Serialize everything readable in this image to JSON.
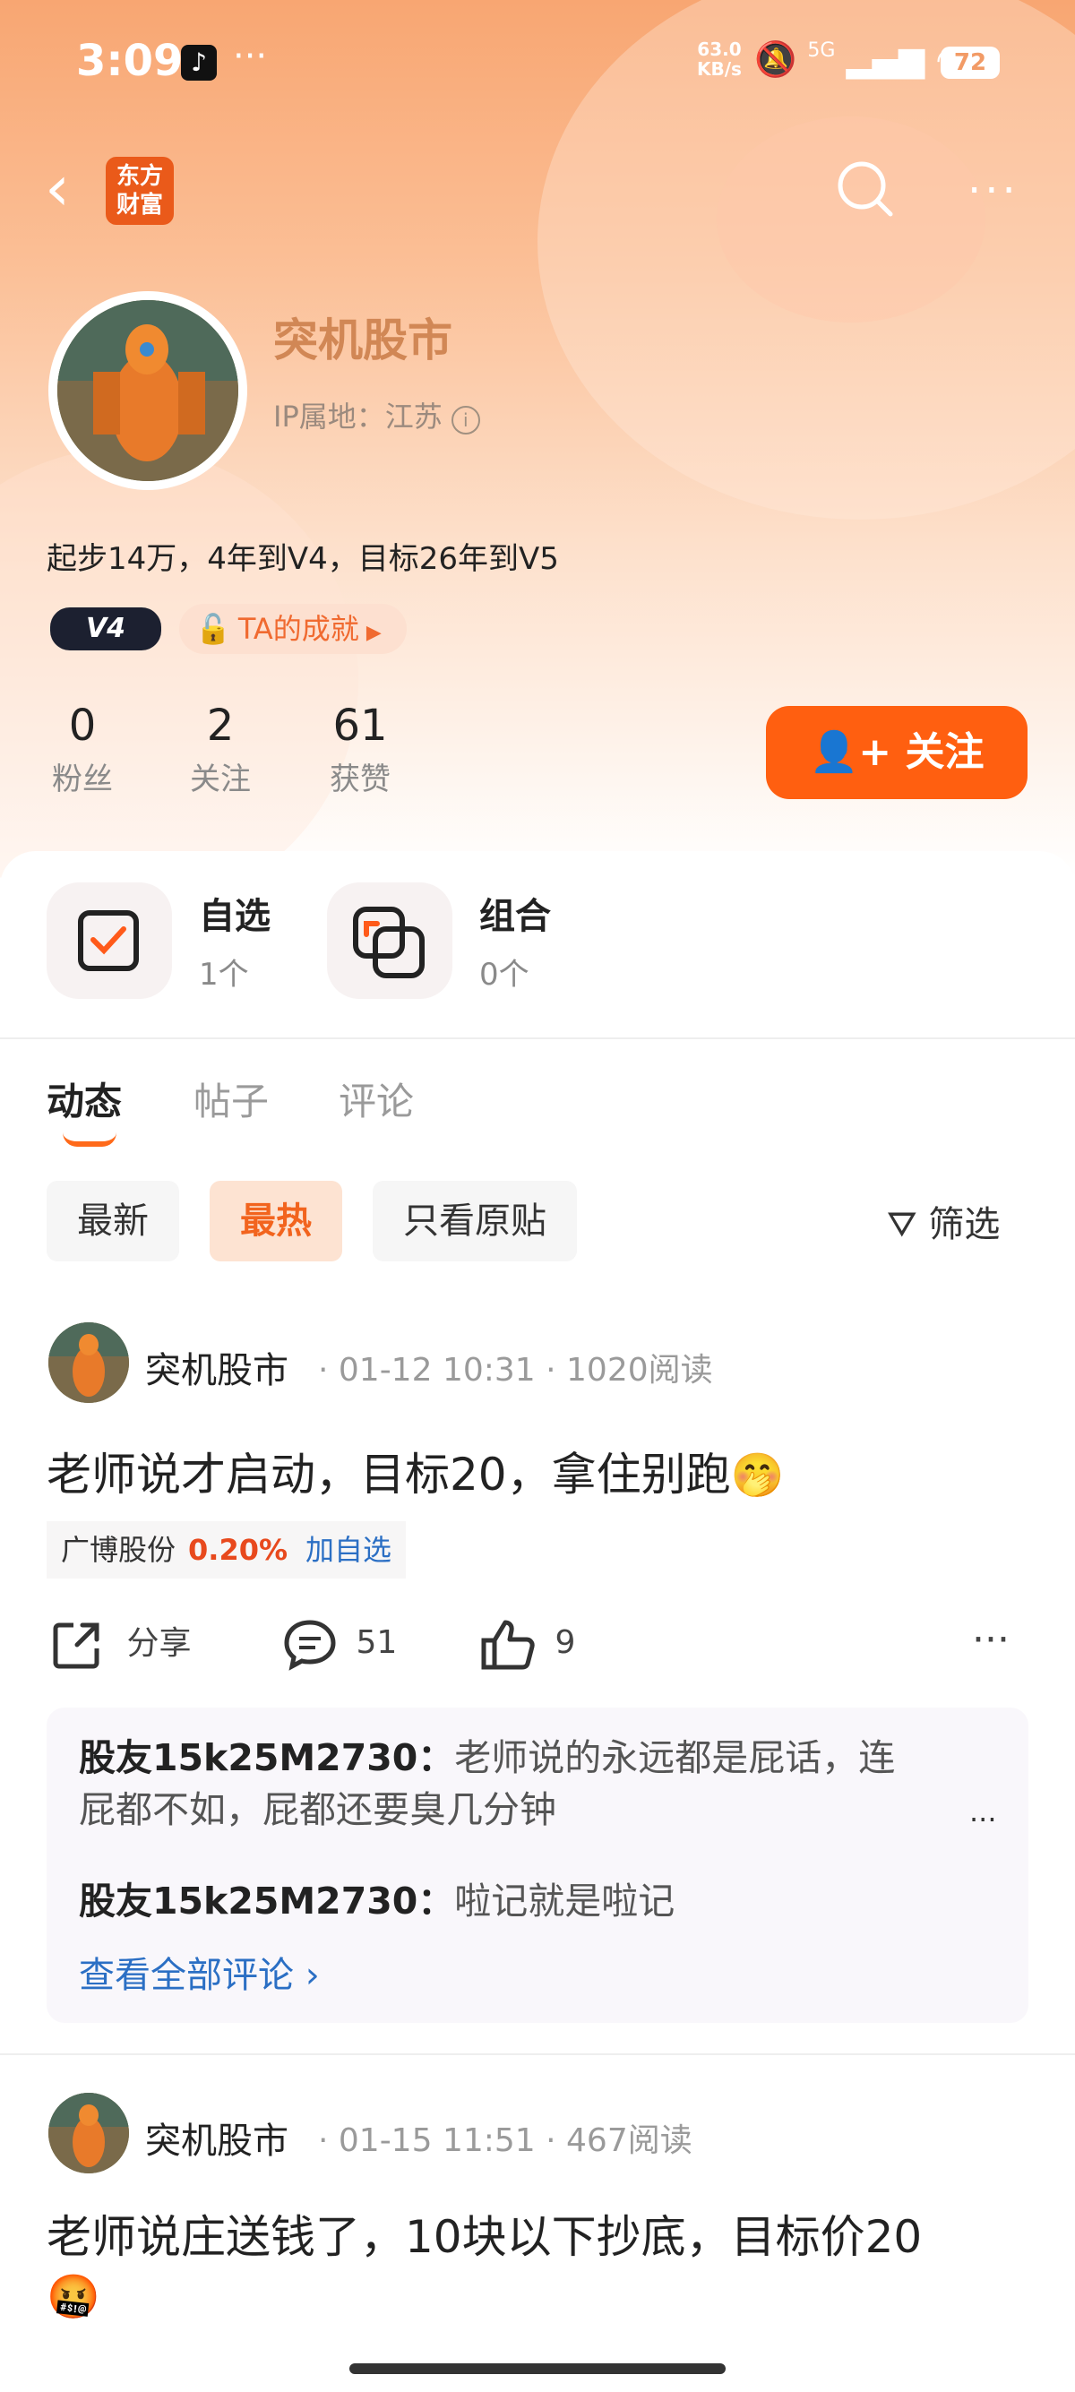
{
  "status_bar": {
    "time": "3:09",
    "net_speed_value": "63.0",
    "net_speed_unit": "KB/s",
    "network": "5G",
    "battery": "72"
  },
  "header": {
    "logo_text": "东方财富"
  },
  "profile": {
    "name": "突机股市",
    "ip_location": "IP属地：江苏",
    "bio": "起步14万，4年到V4，目标26年到V5",
    "level_badge": "V4",
    "achievement": "TA的成就",
    "stats": [
      {
        "value": "0",
        "label": "粉丝"
      },
      {
        "value": "2",
        "label": "关注"
      },
      {
        "value": "61",
        "label": "获赞"
      }
    ],
    "follow_label": "关注"
  },
  "quick_access": [
    {
      "title": "自选",
      "sub": "1个"
    },
    {
      "title": "组合",
      "sub": "0个"
    }
  ],
  "tabs": [
    "动态",
    "帖子",
    "评论"
  ],
  "filters": {
    "chips": [
      "最新",
      "最热",
      "只看原贴"
    ],
    "filter_label": "筛选"
  },
  "posts": [
    {
      "author": "突机股市",
      "meta": "· 01-12 10:31 · 1020阅读",
      "text": "老师说才启动，目标20，拿住别跑",
      "emoji": "🤭",
      "stock": {
        "name": "广博股份",
        "change": "0.20%",
        "add": "加自选"
      },
      "share": "分享",
      "comments": "51",
      "likes": "9",
      "replies": [
        {
          "user": "股友15k25M2730：",
          "line1": "老师说的永远都是屁话，连",
          "line2": "屁都不如，屁都还要臭几分钟"
        },
        {
          "user": "股友15k25M2730：",
          "line1": "啦记就是啦记"
        }
      ],
      "see_all": "查看全部评论 ›"
    },
    {
      "author": "突机股市",
      "meta": "· 01-15 11:51 · 467阅读",
      "text": "老师说庄送钱了，10块以下抄底，目标价20",
      "emoji": "🤬"
    }
  ]
}
